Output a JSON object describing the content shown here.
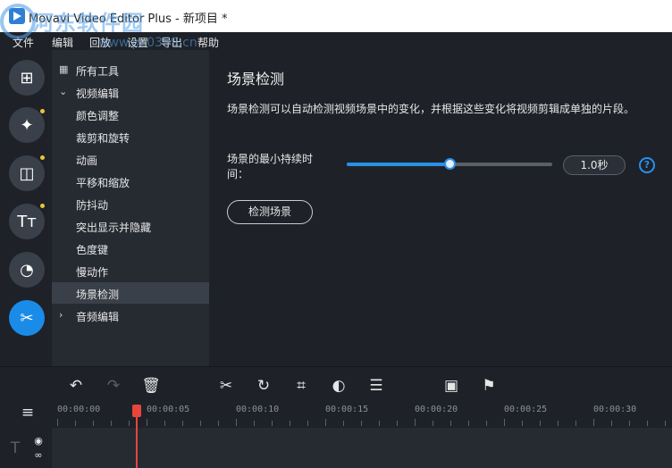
{
  "window": {
    "title": "Movavi Video Editor Plus - 新项目 *",
    "watermark": "河东软件园",
    "watermark_url": "www.pc0359.cn"
  },
  "menu": [
    "文件",
    "编辑",
    "回放",
    "设置",
    "导出",
    "帮助"
  ],
  "rail": [
    {
      "name": "import-icon",
      "glyph": "⊞",
      "badge": false
    },
    {
      "name": "filters-icon",
      "glyph": "✦",
      "badge": true
    },
    {
      "name": "transitions-icon",
      "glyph": "◫",
      "badge": true
    },
    {
      "name": "titles-icon",
      "glyph": "Tт",
      "badge": true
    },
    {
      "name": "stickers-icon",
      "glyph": "◔",
      "badge": false
    },
    {
      "name": "more-tools-icon",
      "glyph": "✂",
      "badge": false,
      "active": true
    }
  ],
  "tree": {
    "all_tools": "所有工具",
    "video_editing": "视频编辑",
    "items": [
      "颜色调整",
      "裁剪和旋转",
      "动画",
      "平移和缩放",
      "防抖动",
      "突出显示并隐藏",
      "色度键",
      "慢动作",
      "场景检测"
    ],
    "audio_editing": "音频编辑"
  },
  "panel": {
    "title": "场景检测",
    "description": "场景检测可以自动检测视频场景中的变化，并根据这些变化将视频剪辑成单独的片段。",
    "min_duration_label": "场景的最小持续时间：",
    "min_duration_value": "1.0秒",
    "slider_fraction": 0.5,
    "help": "?",
    "detect_button": "检测场景"
  },
  "timeline": {
    "tool_icons": [
      "undo-icon",
      "redo-icon",
      "delete-icon",
      "cut-icon",
      "rotate-icon",
      "crop-icon",
      "color-icon",
      "settings-icon",
      "stabilize-icon",
      "marker-icon"
    ],
    "timecodes": [
      "00:00:00",
      "00:00:05",
      "00:00:10",
      "00:00:15",
      "00:00:20",
      "00:00:25",
      "00:00:30"
    ]
  },
  "colors": {
    "accent": "#2a8fea",
    "playhead": "#e8453c",
    "badge": "#e8c53a"
  }
}
